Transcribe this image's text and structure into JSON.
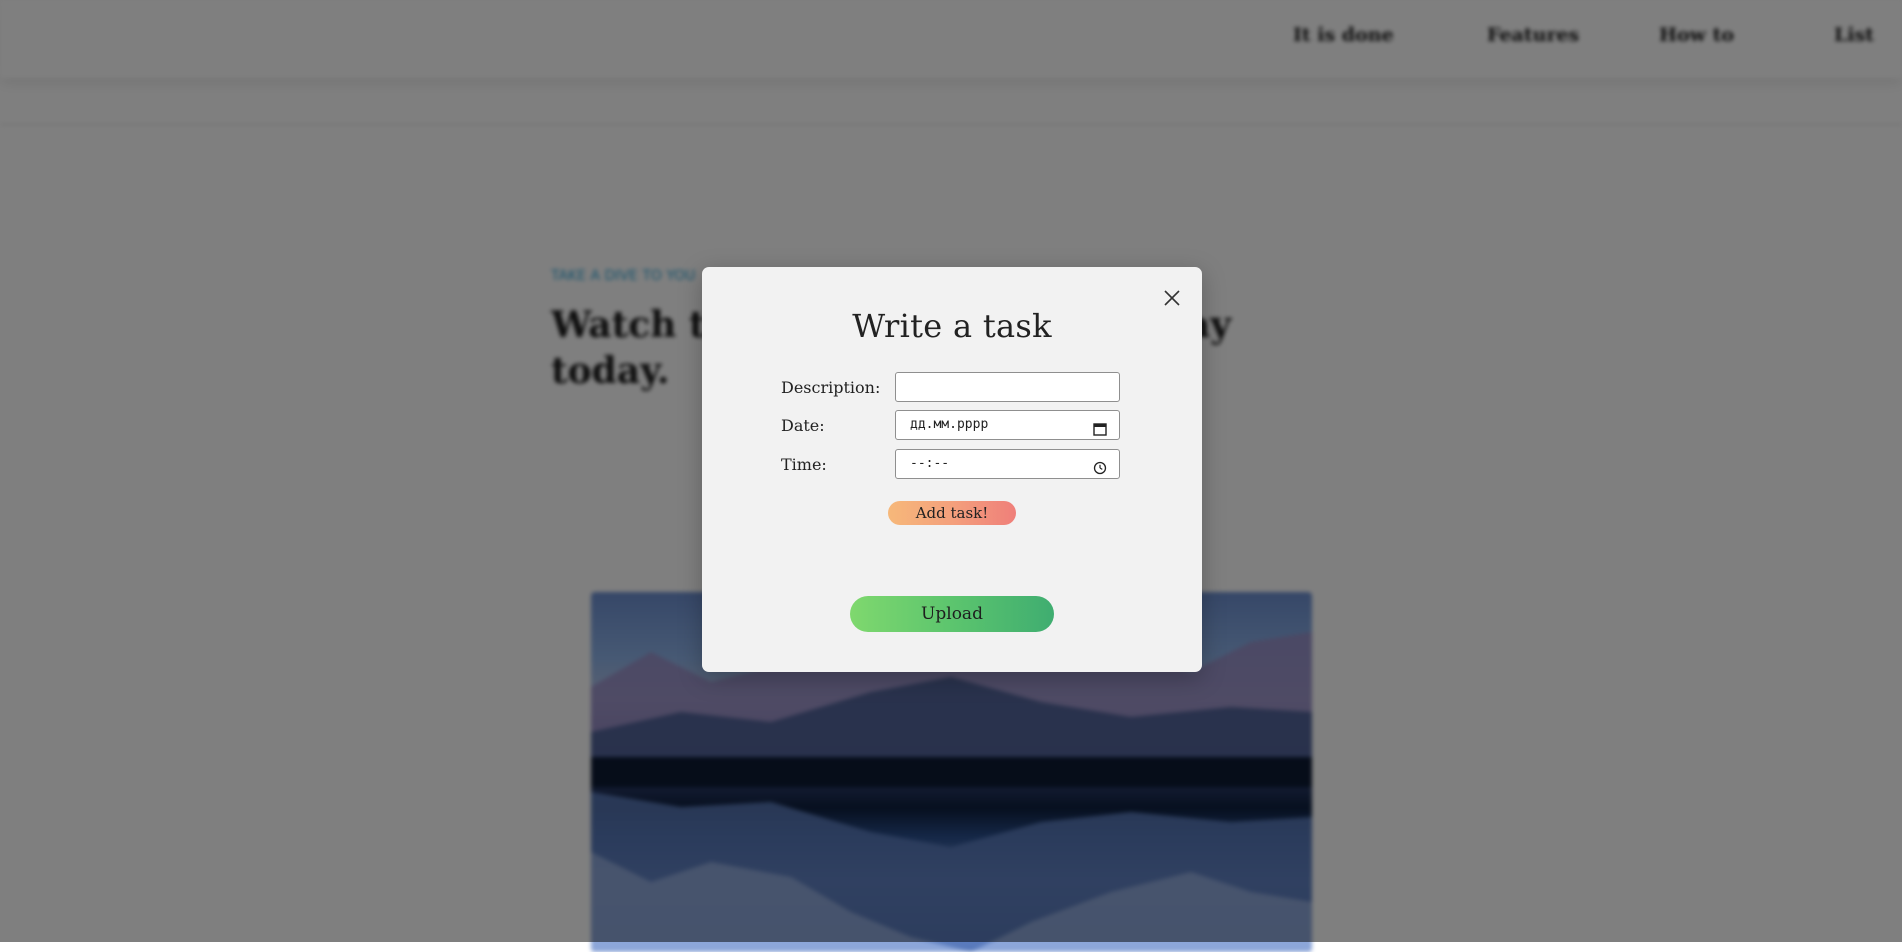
{
  "nav": {
    "items": [
      {
        "label": "It is done"
      },
      {
        "label": "Features"
      },
      {
        "label": "How to"
      },
      {
        "label": "List"
      }
    ]
  },
  "hero": {
    "eyebrow": "TAKE A DIVE TO YOU",
    "title": "Watch the time and plan your day today."
  },
  "modal": {
    "title": "Write a task",
    "close_icon": "close-icon",
    "fields": {
      "description": {
        "label": "Description:",
        "value": ""
      },
      "date": {
        "label": "Date:",
        "value": "дд.мм.рррр"
      },
      "time": {
        "label": "Time:",
        "value": "--:--"
      }
    },
    "add_task_label": "Add task!",
    "upload_label": "Upload"
  },
  "colors": {
    "overlay": "rgba(0,0,0,0.5)",
    "add_task_gradient": [
      "#f6b87a",
      "#ef7f7a"
    ],
    "upload_gradient": [
      "#7fd86e",
      "#3fad70"
    ],
    "eyebrow": "#2aa3d6"
  }
}
